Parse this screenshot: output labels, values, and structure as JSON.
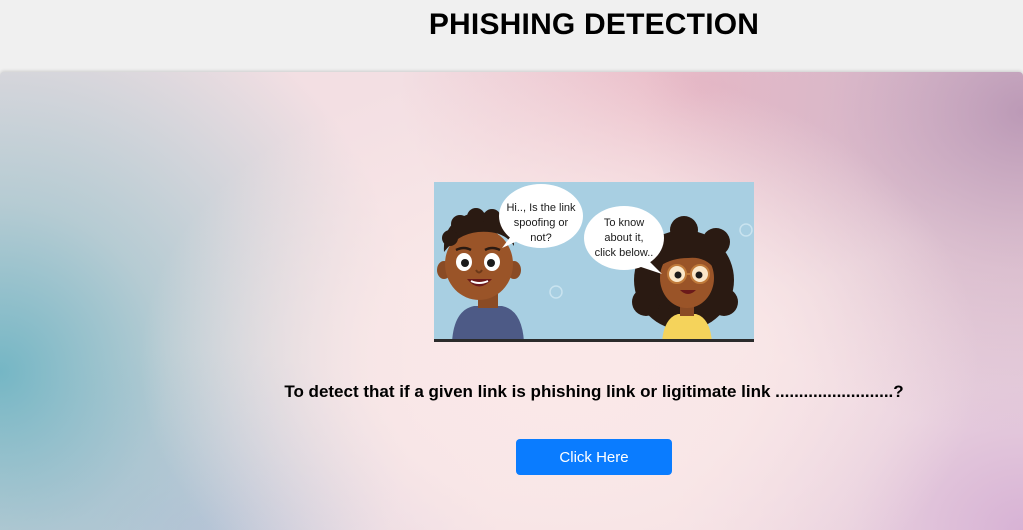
{
  "header": {
    "title": "PHISHING DETECTION"
  },
  "illustration": {
    "boy_bubble_lines": [
      "Hi.., Is the link",
      "spoofing or",
      "not?"
    ],
    "girl_bubble_lines": [
      "To know",
      "about it,",
      "click below.."
    ],
    "background_color": "#a8cfe2"
  },
  "main": {
    "prompt": "To detect that if a given link is phishing link or ligitimate link .........................?",
    "button_label": "Click Here",
    "button_color": "#0a7cff"
  }
}
